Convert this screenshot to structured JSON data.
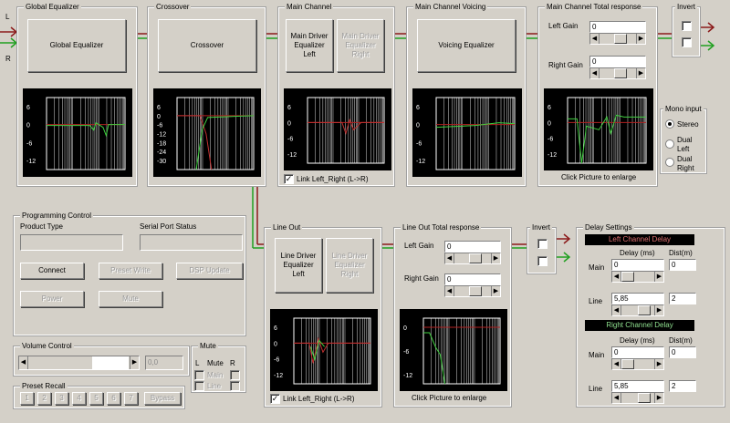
{
  "signal": {
    "input_left": "L",
    "input_right": "R"
  },
  "colors": {
    "left_wire": "#8b1a1a",
    "right_wire": "#20a020",
    "plot_bg": "#000000"
  },
  "global_eq": {
    "title": "Global Equalizer",
    "button": "Global Equalizer",
    "ticks": [
      "6",
      "0",
      "-6",
      "-12"
    ]
  },
  "crossover": {
    "title": "Crossover",
    "button": "Crossover",
    "ticks": [
      "6",
      "0",
      "-6",
      "-12",
      "-18",
      "-24",
      "-30"
    ]
  },
  "main_channel": {
    "title": "Main Channel",
    "btn_left": "Main Driver Equalizer Left",
    "btn_right": "Main Driver Equalizer Right",
    "ticks": [
      "6",
      "0",
      "-6",
      "-12"
    ],
    "link_label": "Link Left_Right (L->R)",
    "link_checked": "✓"
  },
  "voicing": {
    "title": "Main Channel Voicing",
    "button": "Voicing Equalizer",
    "ticks": [
      "6",
      "0",
      "-6",
      "-12"
    ]
  },
  "main_total": {
    "title": "Main Channel Total response",
    "left_gain_label": "Left Gain",
    "left_gain": "0",
    "right_gain_label": "Right Gain",
    "right_gain": "0",
    "ticks": [
      "6",
      "0",
      "-6",
      "-12"
    ],
    "hint": "Click Picture to enlarge"
  },
  "invert_top": {
    "title": "Invert"
  },
  "mono": {
    "title": "Mono input",
    "options": [
      "Stereo",
      "Dual Left",
      "Dual Right"
    ]
  },
  "programming": {
    "title": "Programming Control",
    "product_type_label": "Product Type",
    "serial_status_label": "Serial Port Status",
    "connect": "Connect",
    "preset_write": "Preset Write",
    "dsp_update": "DSP Update",
    "power": "Power",
    "mute": "Mute"
  },
  "volume": {
    "title": "Volume Control",
    "value": "0,0"
  },
  "mute_box": {
    "title": "Mute",
    "col_l": "L",
    "col_mute": "Mute",
    "col_r": "R",
    "row_main": "Main",
    "row_line": "Line"
  },
  "preset": {
    "title": "Preset Recall",
    "buttons": [
      "1",
      "2",
      "3",
      "4",
      "5",
      "6",
      "7"
    ],
    "bypass": "Bypass"
  },
  "line_out": {
    "title": "Line Out",
    "btn_left": "Line Driver Equalizer Left",
    "btn_right": "Line Driver Equalizer Right",
    "ticks": [
      "6",
      "0",
      "-6",
      "-12"
    ],
    "link_label": "Link Left_Right (L->R)",
    "link_checked": "✓"
  },
  "line_total": {
    "title": "Line Out Total response",
    "left_gain_label": "Left Gain",
    "left_gain": "0",
    "right_gain_label": "Right Gain",
    "right_gain": "0",
    "ticks": [
      "0",
      "-6",
      "-12"
    ],
    "hint": "Click Picture to enlarge"
  },
  "invert_bottom": {
    "title": "Invert"
  },
  "delay": {
    "title": "Delay Settings",
    "left_header": "Left Channel Delay",
    "right_header": "Right Channel Delay",
    "col_delay": "Delay (ms)",
    "col_dist": "Dist(m)",
    "left_main_label": "Main",
    "left_main_delay": "0",
    "left_main_dist": "0",
    "left_line_label": "Line",
    "left_line_delay": "5,85",
    "left_line_dist": "2",
    "right_main_label": "Main",
    "right_main_delay": "0",
    "right_main_dist": "0",
    "right_line_label": "Line",
    "right_line_delay": "5,85",
    "right_line_dist": "2"
  }
}
